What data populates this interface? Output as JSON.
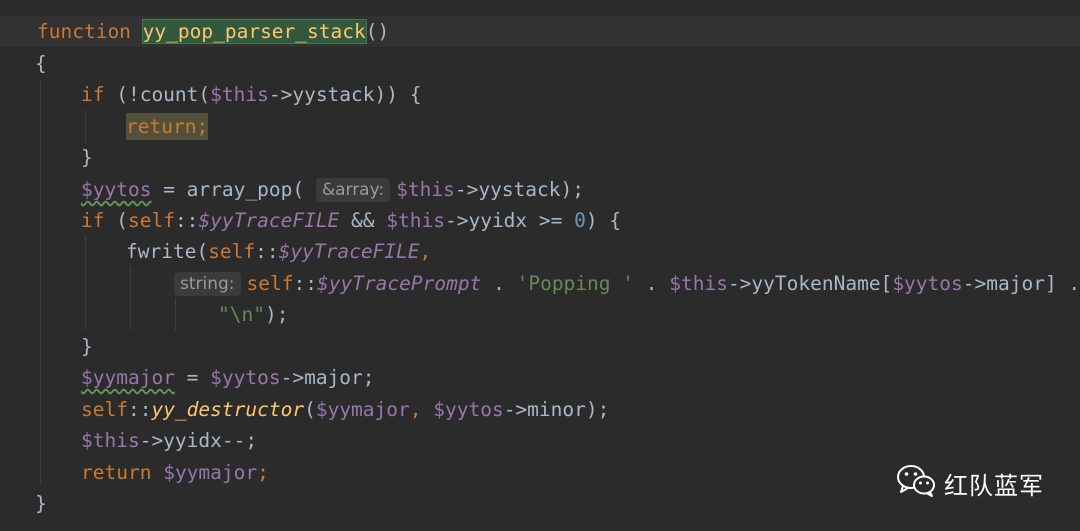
{
  "editor": {
    "code": {
      "l1": {
        "kw": "function",
        "name": "yy_pop_parser_stack",
        "tail": "()"
      },
      "l2": {
        "text": "{"
      },
      "l3": {
        "kw": "if",
        "a": " (!count(",
        "var": "$this",
        "b": "->yystack)) {"
      },
      "l4": {
        "kw": "return",
        "semi": ";"
      },
      "l5": {
        "text": "}"
      },
      "l6": {
        "var": "$yytos",
        "a": " = array_pop( ",
        "hint": "&array:",
        "var2": "$this",
        "b": "->yystack);"
      },
      "l7": {
        "kw": "if",
        "a": " (",
        "self": "self",
        "c": "::",
        "static": "$yyTraceFILE",
        "b": " && ",
        "var": "$this",
        "d": "->yyidx >= ",
        "num": "0",
        "e": ") {"
      },
      "l8": {
        "fn": "fwrite(",
        "self": "self",
        "c": "::",
        "static": "$yyTraceFILE",
        "comma": ","
      },
      "l9": {
        "hint": "string:",
        "self": "self",
        "c": "::",
        "static": "$yyTracePrompt",
        "a": " . ",
        "str": "'Popping '",
        "b": " . ",
        "var": "$this",
        "d": "->yyTokenName[",
        "var2": "$yytos",
        "e": "->major] ."
      },
      "l10": {
        "str": "\"\\n\"",
        "tail": ");"
      },
      "l11": {
        "text": "}"
      },
      "l12": {
        "var": "$yymajor",
        "a": " = ",
        "var2": "$yytos",
        "b": "->major;"
      },
      "l13": {
        "self": "self",
        "c": "::",
        "fn": "yy_destructor",
        "a": "(",
        "var": "$yymajor",
        "comma": ", ",
        "var2": "$yytos",
        "b": "->minor);"
      },
      "l14": {
        "var": "$this",
        "a": "->yyidx--;"
      },
      "l15": {
        "kw": "return",
        "sp": " ",
        "var": "$yymajor",
        "semi": ";"
      },
      "l16": {
        "text": "}"
      }
    }
  },
  "watermark": {
    "text": "红队蓝军",
    "icon": "wechat-icon"
  }
}
